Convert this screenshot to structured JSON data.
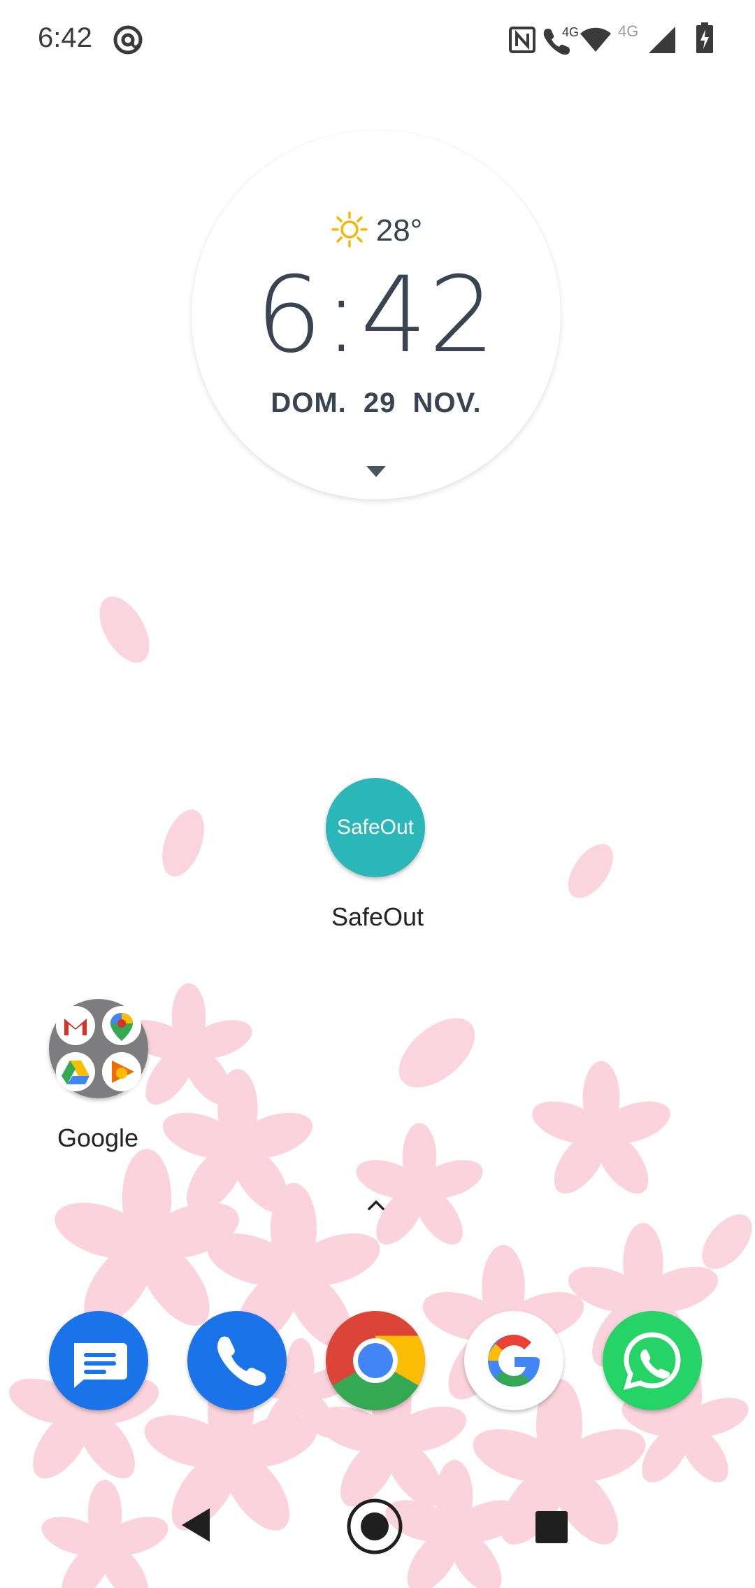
{
  "status_bar": {
    "time": "6:42",
    "icons": [
      "at-sign-icon",
      "nfc-icon",
      "volte-call-icon",
      "wifi-icon",
      "cell-signal-icon",
      "battery-charging-icon"
    ],
    "network_labels": [
      "4G",
      "4G"
    ]
  },
  "clock_widget": {
    "weather_icon": "sun-icon",
    "temperature": "28°",
    "time": "6:42",
    "date": "DOM. 29 NOV."
  },
  "home_apps": [
    {
      "label": "SafeOut",
      "icon_text": "SafeOut",
      "color": "#2bb6b8"
    },
    {
      "label": "Google",
      "type": "folder",
      "contents": [
        "gmail-icon",
        "maps-icon",
        "drive-icon",
        "play-music-icon"
      ]
    }
  ],
  "dock": [
    {
      "name": "messages-icon",
      "color": "#1a73e8"
    },
    {
      "name": "phone-icon",
      "color": "#1a73e8"
    },
    {
      "name": "chrome-icon",
      "color": "#db4437"
    },
    {
      "name": "google-icon",
      "color": "#ffffff"
    },
    {
      "name": "whatsapp-icon",
      "color": "#25d366"
    }
  ],
  "navigation": [
    "back-button",
    "home-button",
    "recents-button"
  ],
  "colors": {
    "clock_text": "#3a4450",
    "safeout_teal": "#2bb6b8",
    "petal_pink": "#f6b3c2"
  }
}
